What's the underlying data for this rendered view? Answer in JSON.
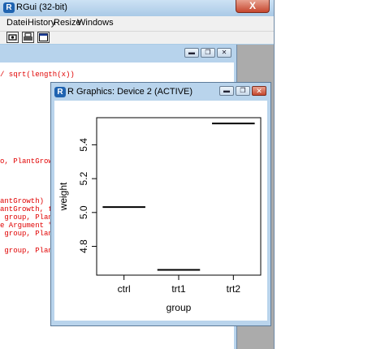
{
  "main_window": {
    "title": "RGui (32-bit)",
    "close_symbol": "X",
    "menu": [
      {
        "label": "Datei"
      },
      {
        "label": "History"
      },
      {
        "label": "Resize"
      },
      {
        "label": "Windows"
      }
    ],
    "toolbar": {
      "icons": [
        "open-script-icon",
        "print-icon",
        "window-icon"
      ]
    }
  },
  "console": {
    "buttons": {
      "minimize": "▬",
      "restore": "❐",
      "close": "✕"
    },
    "lines": [
      "/ sqrt(length(x))",
      "o, PlantGrow",
      "antGrowth)",
      "antGrowth, t",
      " group, Plant",
      "e Argument \"",
      " group, Plant",
      " group, Plant"
    ]
  },
  "graphics_window": {
    "title": "R Graphics: Device 2 (ACTIVE)",
    "buttons": {
      "minimize": "▬",
      "restore": "❐",
      "close": "✕"
    }
  },
  "chart_data": {
    "type": "line",
    "categories": [
      "ctrl",
      "trt1",
      "trt2"
    ],
    "values": [
      5.032,
      4.661,
      5.526
    ],
    "xlabel": "group",
    "ylabel": "weight",
    "yticks": [
      4.8,
      5.0,
      5.2,
      5.4
    ],
    "ylim": [
      4.63,
      5.56
    ],
    "colors": {
      "line": "#000000",
      "axis": "#000000"
    }
  }
}
